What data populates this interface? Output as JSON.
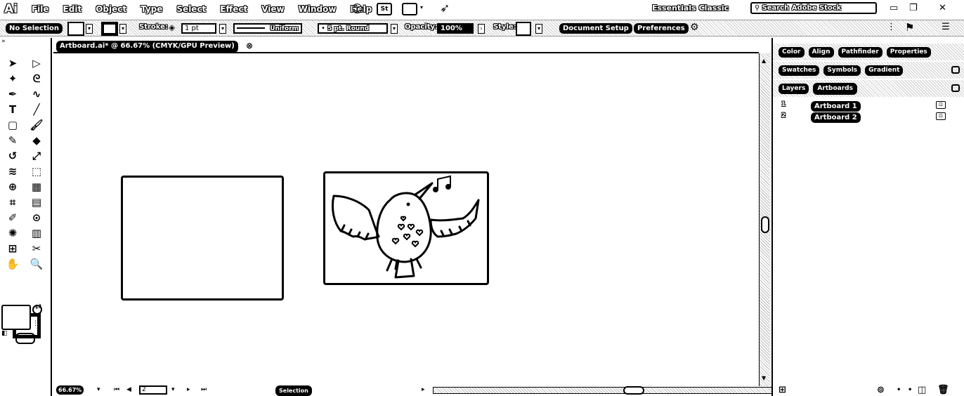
{
  "app": {
    "logo": "Ai",
    "menus": [
      "File",
      "Edit",
      "Object",
      "Type",
      "Select",
      "Effect",
      "View",
      "Window",
      "Help"
    ],
    "st_badge": "St",
    "workspace": "Essentials Classic",
    "search_placeholder": "Search Adobe Stock"
  },
  "control_bar": {
    "selection_label": "No Selection",
    "stroke_label": "Stroke:",
    "stroke_weight": "1 pt",
    "stroke_profile": "Uniform",
    "brush": "5 pt. Round",
    "opacity_label": "Opacity:",
    "opacity_value": "100%",
    "style_label": "Style:",
    "document_setup": "Document Setup",
    "preferences": "Preferences"
  },
  "document": {
    "tab_title": "Artboard.ai* @ 66.67% (CMYK/GPU Preview)"
  },
  "status_bar": {
    "zoom": "66.67%",
    "artboard_number": "2",
    "tool_name": "Selection"
  },
  "panels": {
    "row1_tabs": [
      "Color",
      "Align",
      "Pathfinder",
      "Properties"
    ],
    "row2_tabs": [
      "Swatches",
      "Symbols",
      "Gradient"
    ],
    "row3_tabs": [
      "Layers",
      "Artboards"
    ],
    "artboards": [
      {
        "number": "1",
        "name": "Artboard 1"
      },
      {
        "number": "2",
        "name": "Artboard 2"
      }
    ]
  },
  "tools": [
    "selection-tool",
    "direct-selection-tool",
    "magic-wand-tool",
    "lasso-tool",
    "pen-tool",
    "curvature-tool",
    "type-tool",
    "line-tool",
    "rectangle-tool",
    "paintbrush-tool",
    "shaper-tool",
    "eraser-tool",
    "rotate-tool",
    "scale-tool",
    "width-tool",
    "free-transform-tool",
    "shape-builder-tool",
    "perspective-grid-tool",
    "mesh-tool",
    "gradient-tool",
    "eyedropper-tool",
    "blend-tool",
    "symbol-sprayer-tool",
    "column-graph-tool",
    "artboard-tool",
    "slice-tool",
    "hand-tool",
    "zoom-tool"
  ]
}
